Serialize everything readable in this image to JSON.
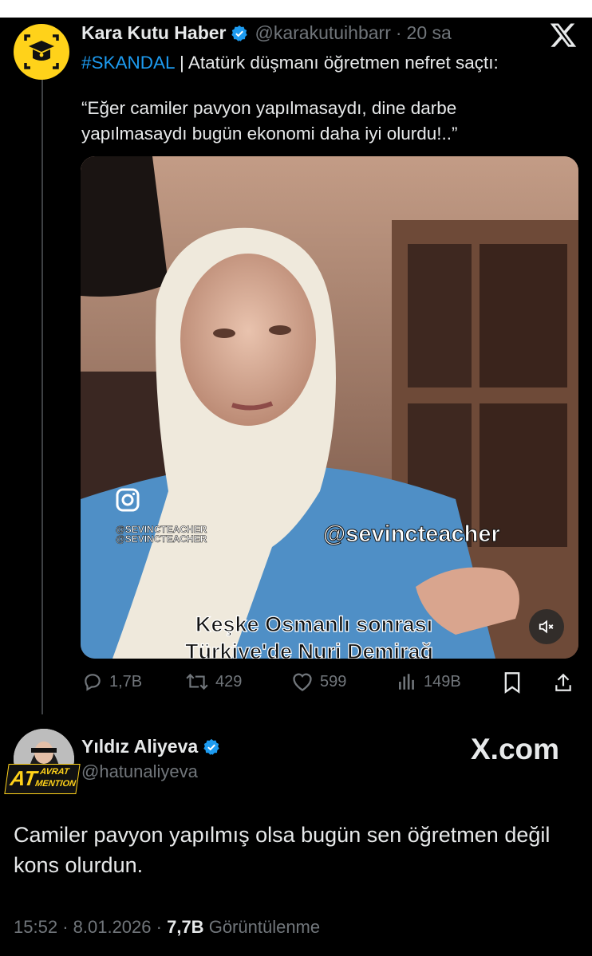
{
  "tweet1": {
    "author_name": "Kara Kutu Haber",
    "handle": "@karakutuihbarr",
    "separator": "·",
    "time": "20 sa",
    "hashtag": "#SKANDAL",
    "text": " | Atatürk düşmanı öğretmen nefret saçtı:",
    "quote_line1": "“Eğer camiler pavyon yapılmasaydı, dine darbe",
    "quote_line2": "yapılmasaydı bugün ekonomi daha iyi olurdu!..”",
    "video": {
      "watermark": "@sevincteacher",
      "watermark_small_1": "@SEVINCTEACHER",
      "watermark_small_2": "@SEVINCTEACHER",
      "caption_line1": "Keşke Osmanlı sonrası",
      "caption_line2": "Türkiye'de Nuri Demirağ"
    },
    "stats": {
      "replies": "1,7B",
      "reposts": "429",
      "likes": "599",
      "views": "149B"
    }
  },
  "tweet2": {
    "author_name": "Yıldız Aliyeva",
    "handle": "@hatunaliyeva",
    "avatar_badge_big": "AT",
    "avatar_badge_1": "AVRAT",
    "avatar_badge_2": "MENTION",
    "brand": "X.com",
    "body_line1": "Camiler pavyon yapılmış olsa bugün sen öğretmen değil",
    "body_line2": "kons olurdun.",
    "time": "15:52",
    "date": "8.01.2026",
    "views_count": "7,7B",
    "views_label": "Görüntülenme"
  },
  "colors": {
    "background": "#000000",
    "text": "#e7e9ea",
    "secondary": "#71767b",
    "accent": "#1d9bf0",
    "avatar_yellow": "#ffd21a"
  },
  "icons": [
    "verified-icon",
    "x-logo-icon",
    "reply-icon",
    "repost-icon",
    "like-icon",
    "views-icon",
    "bookmark-icon",
    "share-icon",
    "mute-icon",
    "instagram-icon"
  ]
}
